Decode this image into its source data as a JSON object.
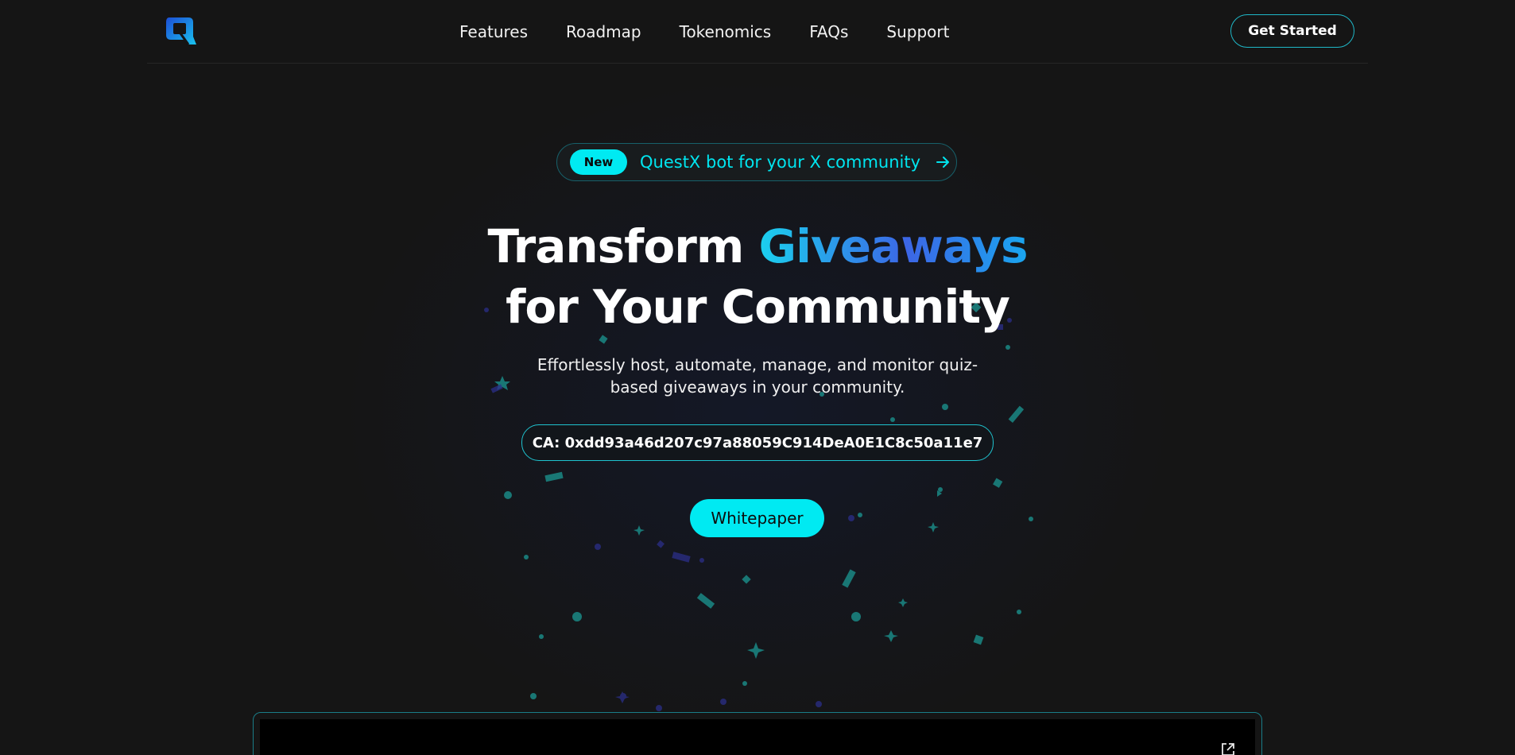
{
  "nav": {
    "links": [
      "Features",
      "Roadmap",
      "Tokenomics",
      "FAQs",
      "Support"
    ],
    "cta_label": "Get Started"
  },
  "announcement": {
    "badge": "New",
    "text": "QuestX bot for your X community"
  },
  "hero": {
    "headline_line1_plain": "Transform",
    "headline_line1_accent": "Giveaways",
    "headline_line2": "for Your Community",
    "subtitle": "Effortlessly host, automate, manage, and monitor quiz-based giveaways in your community.",
    "contract_address": "CA: 0xdd93a46d207c97a88059C914DeA0E1C8c50a11e7",
    "whitepaper_label": "Whitepaper"
  },
  "colors": {
    "background": "#151515",
    "accent_cyan": "#00eaf2",
    "accent_blue": "#3c66e6",
    "border_teal": "#1fc3cf"
  },
  "icons": {
    "logo": "questx-q-logo",
    "announcement": "arrow-right-icon",
    "video": "external-link-icon"
  }
}
